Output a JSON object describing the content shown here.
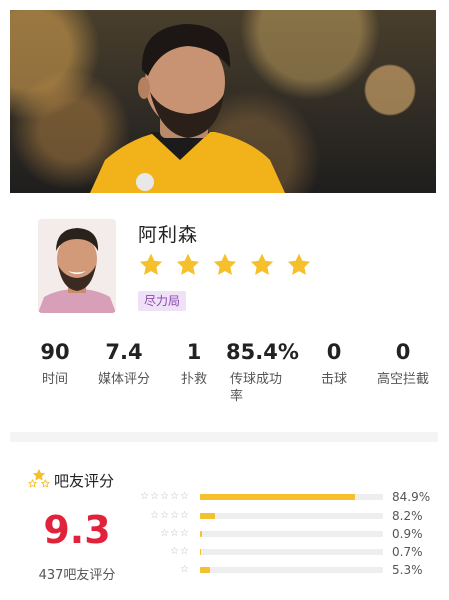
{
  "player": {
    "name": "阿利森",
    "rating_stars": 5,
    "badge": "尽力局"
  },
  "stats": [
    {
      "value": "90",
      "label": "时间"
    },
    {
      "value": "7.4",
      "label": "媒体评分"
    },
    {
      "value": "1",
      "label": "扑救"
    },
    {
      "value": "85.4%",
      "label": "传球成功率"
    },
    {
      "value": "0",
      "label": "击球"
    },
    {
      "value": "0",
      "label": "高空拦截"
    }
  ],
  "fan_rating": {
    "title": "吧友评分",
    "score": "9.3",
    "count_label": "437吧友评分",
    "distribution": [
      {
        "stars": 5,
        "percent": "84.9%",
        "fraction": 0.849
      },
      {
        "stars": 4,
        "percent": "8.2%",
        "fraction": 0.082
      },
      {
        "stars": 3,
        "percent": "0.9%",
        "fraction": 0.009
      },
      {
        "stars": 2,
        "percent": "0.7%",
        "fraction": 0.007
      },
      {
        "stars": 1,
        "percent": "5.3%",
        "fraction": 0.053
      }
    ]
  },
  "colors": {
    "star": "#f5c02c",
    "score": "#e0223a",
    "badge_bg": "#efe1f6",
    "badge_text": "#8a4ab0",
    "bar": "#f5c02c"
  }
}
